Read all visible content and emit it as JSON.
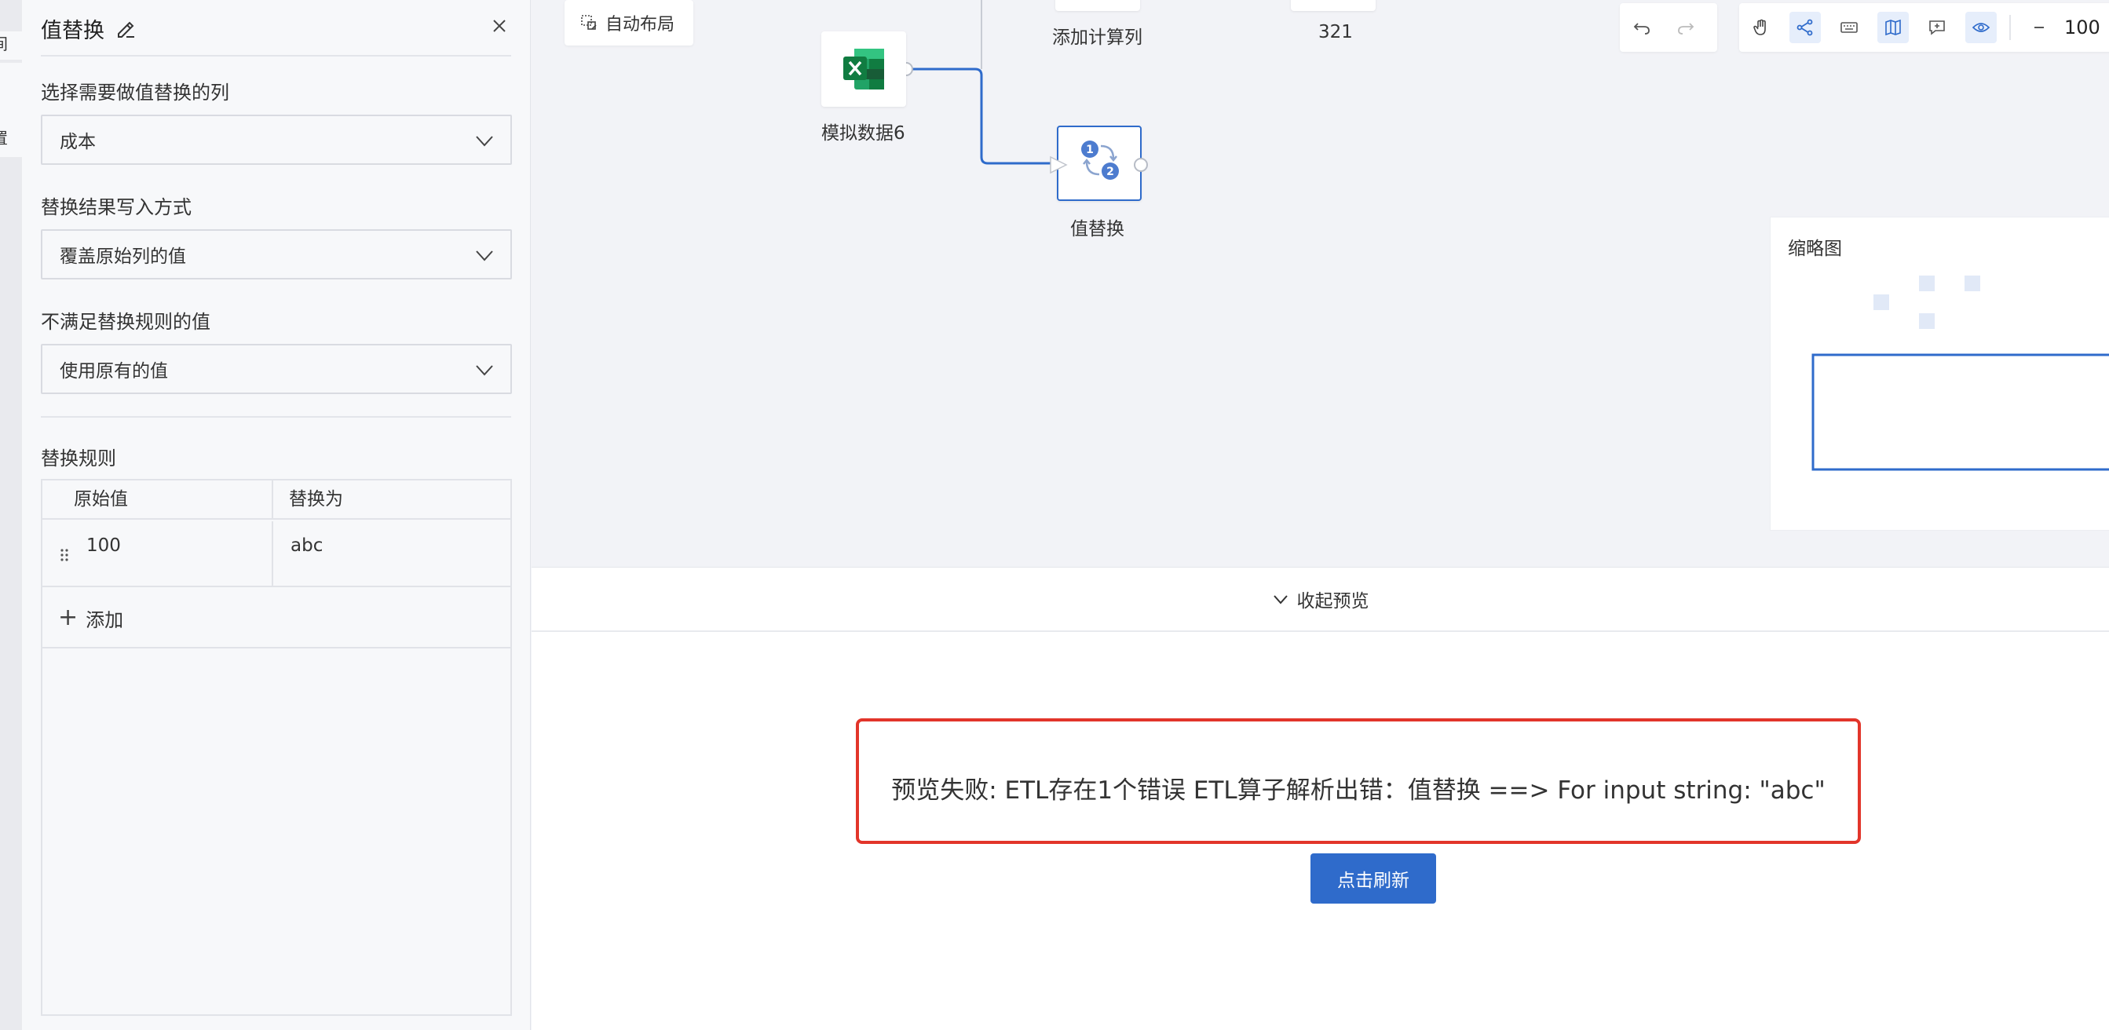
{
  "left_strip": {
    "tab1": "间",
    "tab2": "置"
  },
  "panel": {
    "title": "值替换",
    "column_label": "选择需要做值替换的列",
    "column_value": "成本",
    "write_mode_label": "替换结果写入方式",
    "write_mode_value": "覆盖原始列的值",
    "unmatched_label": "不满足替换规则的值",
    "unmatched_value": "使用原有的值",
    "rules_label": "替换规则",
    "rules_headers": {
      "original": "原始值",
      "replace": "替换为"
    },
    "rules": [
      {
        "original": "100",
        "replace": "abc"
      }
    ],
    "add_label": "添加"
  },
  "canvas": {
    "auto_layout": "自动布局",
    "nodes": {
      "excel": "模拟数据6",
      "value_replace": "值替换",
      "add_calc": "添加计算列",
      "n321": "321"
    },
    "zoom": "100",
    "minimap_title": "缩略图"
  },
  "preview": {
    "collapse": "收起预览",
    "error": "预览失败: ETL存在1个错误 ETL算子解析出错：值替换 ==> For input string: \"abc\"",
    "refresh": "点击刷新"
  },
  "colors": {
    "accent": "#2f6bcb",
    "error_border": "#e2352a",
    "excel_green": "#1d6f42"
  },
  "icons": [
    "edit-icon",
    "close-icon",
    "chevron-down-icon",
    "drag-handle-icon",
    "plus-icon",
    "auto-layout-icon",
    "excel-icon",
    "value-replace-icon",
    "undo-icon",
    "redo-icon",
    "hand-icon",
    "share-icon",
    "keyboard-icon",
    "map-icon",
    "comment-icon",
    "eye-icon",
    "minus-icon"
  ]
}
